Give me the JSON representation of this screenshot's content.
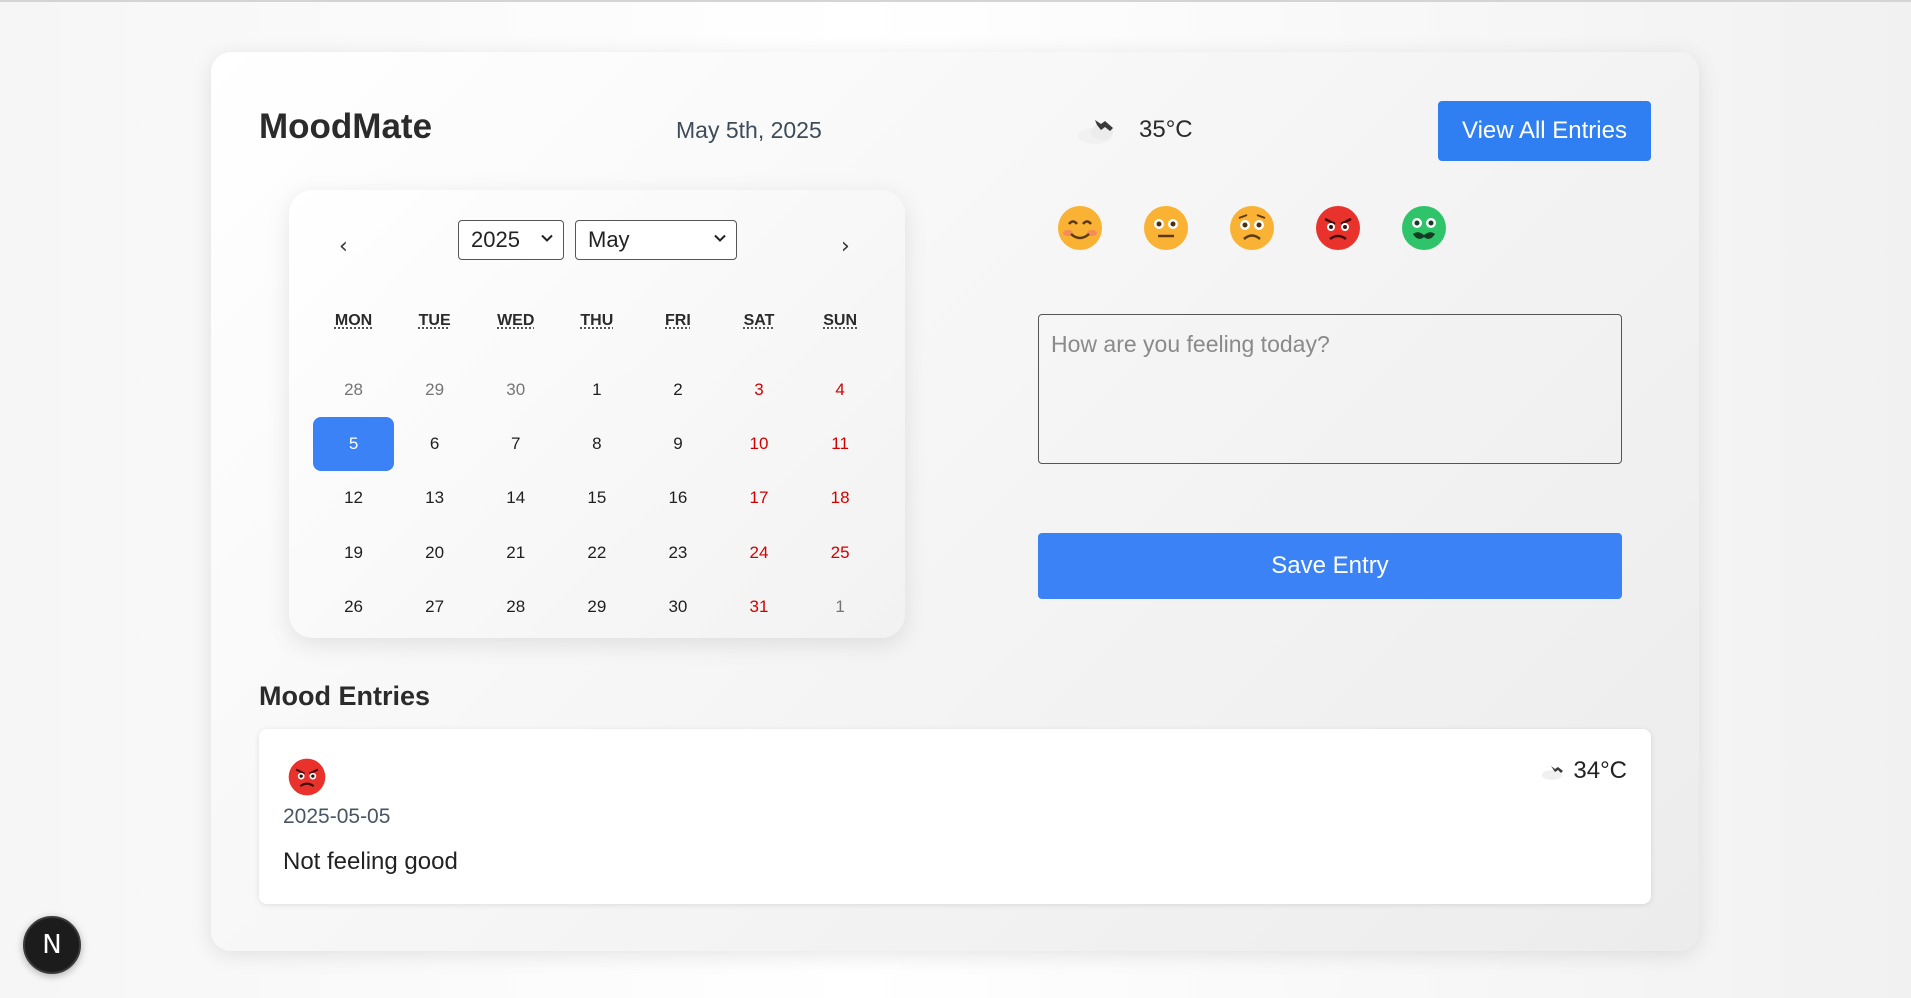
{
  "app": {
    "title": "MoodMate"
  },
  "header": {
    "date": "May 5th, 2025",
    "weather": {
      "icon": "cloud-bird-icon",
      "temp": "35°C"
    },
    "view_all_label": "View All Entries"
  },
  "calendar": {
    "prev_label": "‹",
    "next_label": "›",
    "year_selected": "2025",
    "month_selected": "May",
    "weekdays": [
      "MON",
      "TUE",
      "WED",
      "THU",
      "FRI",
      "SAT",
      "SUN"
    ],
    "days": [
      {
        "label": "28",
        "kind": "other"
      },
      {
        "label": "29",
        "kind": "other"
      },
      {
        "label": "30",
        "kind": "other"
      },
      {
        "label": "1",
        "kind": "normal"
      },
      {
        "label": "2",
        "kind": "normal"
      },
      {
        "label": "3",
        "kind": "weekend"
      },
      {
        "label": "4",
        "kind": "weekend"
      },
      {
        "label": "5",
        "kind": "selected"
      },
      {
        "label": "6",
        "kind": "normal"
      },
      {
        "label": "7",
        "kind": "normal"
      },
      {
        "label": "8",
        "kind": "normal"
      },
      {
        "label": "9",
        "kind": "normal"
      },
      {
        "label": "10",
        "kind": "weekend"
      },
      {
        "label": "11",
        "kind": "weekend"
      },
      {
        "label": "12",
        "kind": "normal"
      },
      {
        "label": "13",
        "kind": "normal"
      },
      {
        "label": "14",
        "kind": "normal"
      },
      {
        "label": "15",
        "kind": "normal"
      },
      {
        "label": "16",
        "kind": "normal"
      },
      {
        "label": "17",
        "kind": "weekend"
      },
      {
        "label": "18",
        "kind": "weekend"
      },
      {
        "label": "19",
        "kind": "normal"
      },
      {
        "label": "20",
        "kind": "normal"
      },
      {
        "label": "21",
        "kind": "normal"
      },
      {
        "label": "22",
        "kind": "normal"
      },
      {
        "label": "23",
        "kind": "normal"
      },
      {
        "label": "24",
        "kind": "weekend"
      },
      {
        "label": "25",
        "kind": "weekend"
      },
      {
        "label": "26",
        "kind": "normal"
      },
      {
        "label": "27",
        "kind": "normal"
      },
      {
        "label": "28",
        "kind": "normal"
      },
      {
        "label": "29",
        "kind": "normal"
      },
      {
        "label": "30",
        "kind": "normal"
      },
      {
        "label": "31",
        "kind": "weekend"
      },
      {
        "label": "1",
        "kind": "other"
      }
    ]
  },
  "moods": [
    {
      "name": "happy",
      "icon": "smiling-face-icon"
    },
    {
      "name": "neutral",
      "icon": "neutral-face-icon"
    },
    {
      "name": "sad",
      "icon": "worried-face-icon"
    },
    {
      "name": "angry",
      "icon": "angry-face-icon"
    },
    {
      "name": "sick",
      "icon": "nauseated-face-icon"
    }
  ],
  "entry_form": {
    "placeholder": "How are you feeling today?",
    "save_label": "Save Entry"
  },
  "entries_section": {
    "title": "Mood Entries",
    "entries": [
      {
        "mood_icon": "angry-face-icon",
        "date": "2025-05-05",
        "text": "Not feeling good",
        "weather_icon": "cloud-bird-icon",
        "temp": "34°C"
      }
    ]
  },
  "dev_badge": {
    "label": "N"
  },
  "colors": {
    "primary": "#3b82f6",
    "weekend": "#d10000",
    "text": "#2b2b2b"
  }
}
